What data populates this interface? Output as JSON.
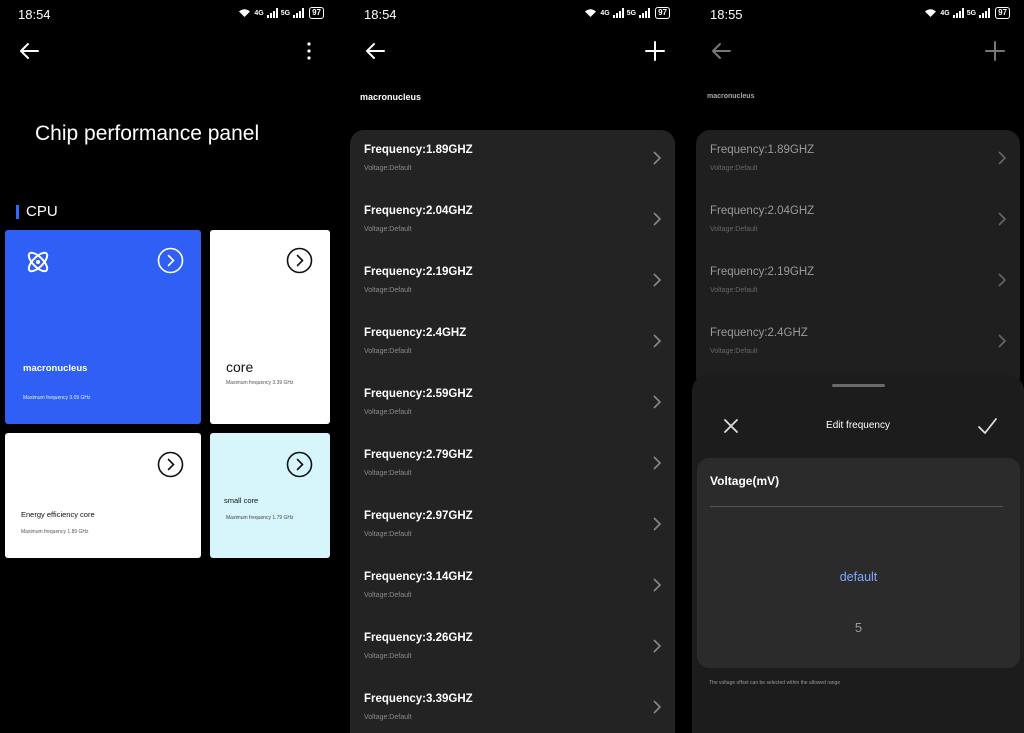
{
  "screen1": {
    "time": "18:54",
    "battery": "97",
    "page_title": "Chip performance panel",
    "section": "CPU",
    "cards": [
      {
        "name": "macronucleus",
        "sub": "Maximum frequency 3.09 GHz",
        "bg": "#2f5ff5",
        "text": "#ffffff"
      },
      {
        "name": "core",
        "sub": "Maximum frequency 3.39 GHz",
        "bg": "#ffffff",
        "text": "#111111"
      },
      {
        "name": "Energy efficiency core",
        "sub": "Maximum frequency 1.89 GHz",
        "bg": "#ffffff",
        "text": "#111111"
      },
      {
        "name": "small core",
        "sub": "Maximum frequency 1.79 GHz",
        "bg": "#d7f6fb",
        "text": "#111111"
      }
    ]
  },
  "screen2": {
    "time": "18:54",
    "battery": "97",
    "header_label": "macronucleus",
    "rows": [
      {
        "freq": "Frequency:1.89GHZ",
        "volt": "Voltage:Default"
      },
      {
        "freq": "Frequency:2.04GHZ",
        "volt": "Voltage:Default"
      },
      {
        "freq": "Frequency:2.19GHZ",
        "volt": "Voltage:Default"
      },
      {
        "freq": "Frequency:2.4GHZ",
        "volt": "Voltage:Default"
      },
      {
        "freq": "Frequency:2.59GHZ",
        "volt": "Voltage:Default"
      },
      {
        "freq": "Frequency:2.79GHZ",
        "volt": "Voltage:Default"
      },
      {
        "freq": "Frequency:2.97GHZ",
        "volt": "Voltage:Default"
      },
      {
        "freq": "Frequency:3.14GHZ",
        "volt": "Voltage:Default"
      },
      {
        "freq": "Frequency:3.26GHZ",
        "volt": "Voltage:Default"
      },
      {
        "freq": "Frequency:3.39GHZ",
        "volt": "Voltage:Default"
      }
    ]
  },
  "screen3": {
    "time": "18:55",
    "battery": "97",
    "header_label": "macronucleus",
    "rows": [
      {
        "freq": "Frequency:1.89GHZ",
        "volt": "Voltage:Default"
      },
      {
        "freq": "Frequency:2.04GHZ",
        "volt": "Voltage:Default"
      },
      {
        "freq": "Frequency:2.19GHZ",
        "volt": "Voltage:Default"
      },
      {
        "freq": "Frequency:2.4GHZ",
        "volt": "Voltage:Default"
      }
    ],
    "sheet": {
      "title": "Edit frequency",
      "field_label": "Voltage(mV)",
      "option_selected": "default",
      "option_next": "5",
      "hint": "The voltage offset can be selected within the allowed range"
    }
  },
  "network": {
    "net1": "4G",
    "net2": "5G"
  },
  "colors": {
    "accent": "#2f6bff",
    "picker_selected": "#7fa6ff"
  }
}
